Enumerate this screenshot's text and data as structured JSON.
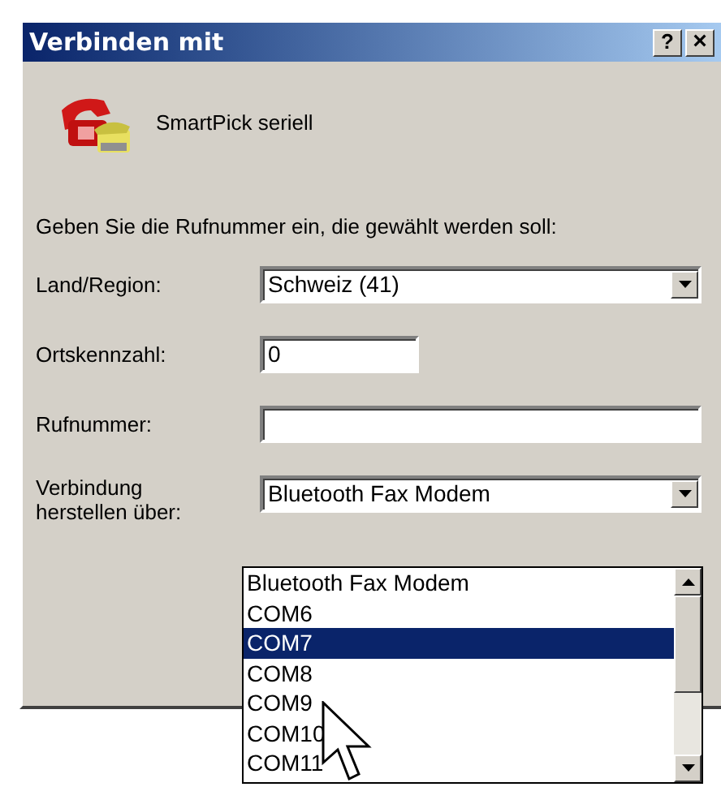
{
  "window": {
    "title": "Verbinden mit",
    "help_button": "?",
    "close_button": "×"
  },
  "connection_name": "SmartPick seriell",
  "instruction": "Geben Sie die Rufnummer ein, die gewählt werden soll:",
  "fields": [
    {
      "kind": "combo",
      "label": "Land/Region:",
      "value": "Schweiz (41)"
    },
    {
      "kind": "short",
      "label": "Ortskennzahl:",
      "value": "0"
    },
    {
      "kind": "text",
      "label": "Rufnummer:"
    },
    {
      "kind": "combo",
      "label": "Verbindung herstellen über:",
      "value": "Bluetooth Fax Modem"
    }
  ],
  "dropdown": {
    "items": [
      {
        "label": "Bluetooth Fax Modem",
        "selected": false
      },
      {
        "label": "COM6",
        "selected": false
      },
      {
        "label": "COM7",
        "selected": true
      },
      {
        "label": "COM8",
        "selected": false
      },
      {
        "label": "COM9",
        "selected": false
      },
      {
        "label": "COM10",
        "selected": false
      },
      {
        "label": "COM11",
        "selected": false
      }
    ]
  }
}
